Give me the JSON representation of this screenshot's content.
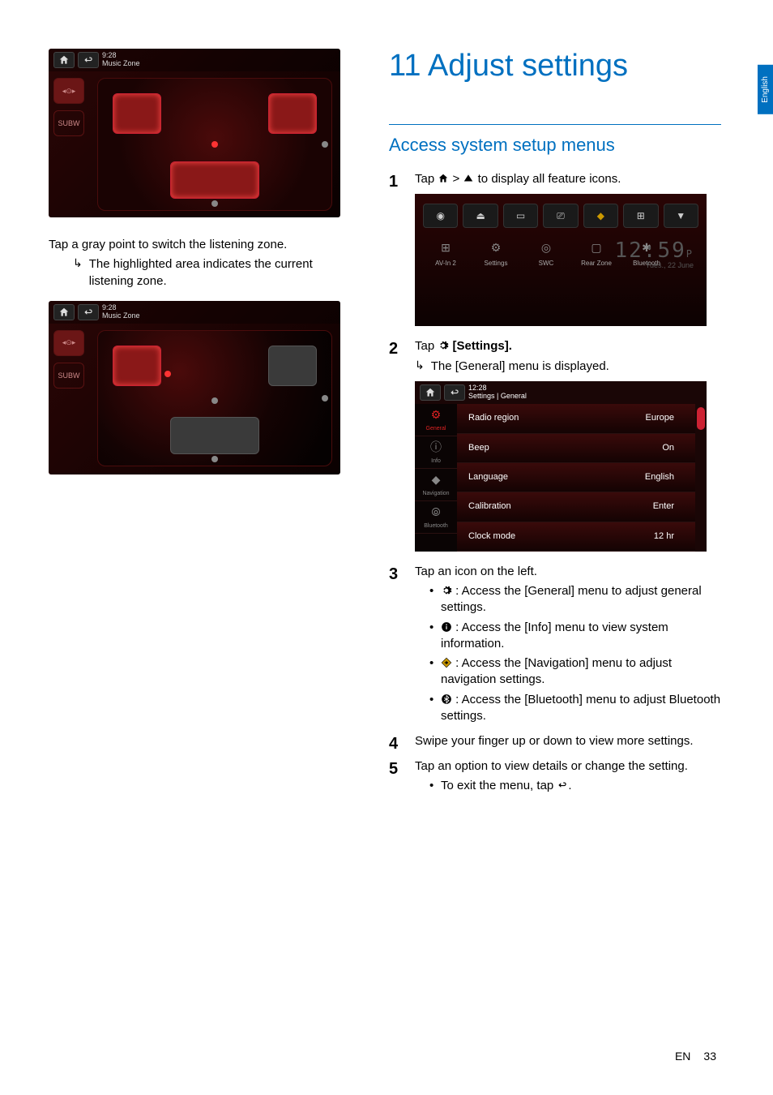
{
  "lang_tab": "English",
  "footer": {
    "lang": "EN",
    "page": "33"
  },
  "chapter_title": "11 Adjust settings",
  "section_title": "Access system setup menus",
  "left": {
    "intro": "Tap a gray point to switch the listening zone.",
    "sub": "The highlighted area indicates the current listening zone."
  },
  "music_zone": {
    "time": "9:28",
    "title": "Music Zone",
    "subw_label": "SUBW"
  },
  "steps": {
    "s1_a": "Tap ",
    "s1_b": " > ",
    "s1_c": " to display all feature icons.",
    "s2_a": "Tap ",
    "s2_b": " [Settings].",
    "s2_sub": "The [General] menu is displayed.",
    "s3": "Tap an icon on the left.",
    "s3_items": {
      "general": ": Access the [General] menu to adjust general settings.",
      "info": ": Access the [Info] menu to view system information.",
      "nav": ": Access the [Navigation] menu to adjust navigation settings.",
      "bt": ": Access the [Bluetooth] menu to adjust Bluetooth settings."
    },
    "s4": "Swipe your finger up or down to view more settings.",
    "s5": "Tap an option to view details or change the setting.",
    "s5_sub": "To exit the menu, tap "
  },
  "feature_icons": {
    "items": [
      "AV-In 2",
      "Settings",
      "SWC",
      "Rear Zone",
      "Bluetooth"
    ],
    "clock": "12:59",
    "ampm": "P",
    "date": "Tues., 22 June"
  },
  "settings_shot": {
    "time": "12:28",
    "breadcrumb": "Settings | General",
    "tabs": [
      "General",
      "Info",
      "Navigation",
      "Bluetooth"
    ],
    "rows": [
      {
        "label": "Radio region",
        "value": "Europe"
      },
      {
        "label": "Beep",
        "value": "On"
      },
      {
        "label": "Language",
        "value": "English"
      },
      {
        "label": "Calibration",
        "value": "Enter"
      },
      {
        "label": "Clock mode",
        "value": "12 hr"
      }
    ]
  }
}
